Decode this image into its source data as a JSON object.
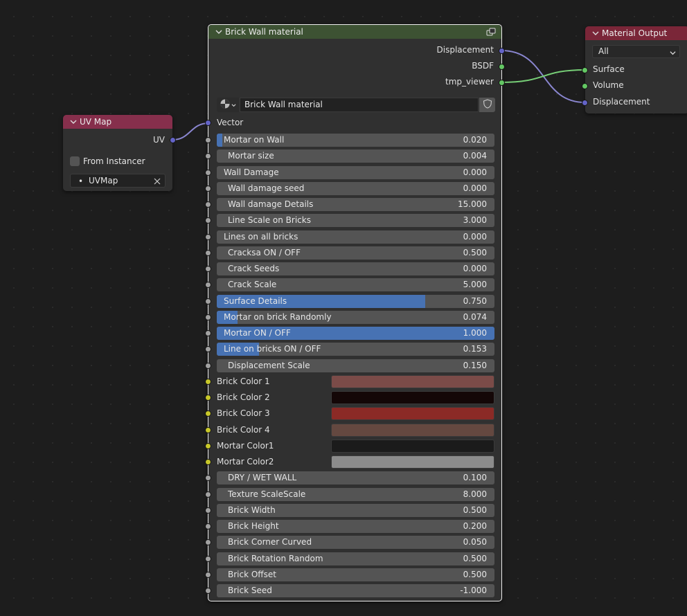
{
  "colors": {
    "main_header": "#3d5233",
    "uv_header": "#862f4c",
    "output_header": "#7a2638",
    "slider_fill": "#4772b3",
    "field_bg": "#545454"
  },
  "uv_node": {
    "title": "UV Map",
    "output_label": "UV",
    "from_instancer_label": "From Instancer",
    "from_instancer_checked": false,
    "uvmap_value": "UVMap"
  },
  "main_node": {
    "title": "Brick Wall material",
    "outputs": [
      "Displacement",
      "BSDF",
      "tmp_viewer"
    ],
    "datablock_name": "Brick Wall material",
    "vector_label": "Vector",
    "inputs": [
      {
        "label": "Mortar on Wall",
        "value": "0.020",
        "fill": 0.02
      },
      {
        "label": "Mortar size",
        "value": "0.004",
        "fill": 0
      },
      {
        "label": "Wall Damage",
        "value": "0.000",
        "fill": 0
      },
      {
        "label": "Wall damage seed",
        "value": "0.000",
        "fill": 0
      },
      {
        "label": "Wall damage Details",
        "value": "15.000",
        "fill": 0
      },
      {
        "label": "Line Scale on Bricks",
        "value": "3.000",
        "fill": 0
      },
      {
        "label": "Lines on all bricks",
        "value": "0.000",
        "fill": 0
      },
      {
        "label": "Cracksa ON / OFF",
        "value": "0.500",
        "fill": 0
      },
      {
        "label": "Crack Seeds",
        "value": "0.000",
        "fill": 0
      },
      {
        "label": "Crack Scale",
        "value": "5.000",
        "fill": 0
      },
      {
        "label": "Surface Details",
        "value": "0.750",
        "fill": 0.75
      },
      {
        "label": "Mortar on brick Randomly",
        "value": "0.074",
        "fill": 0.074
      },
      {
        "label": "Mortar ON / OFF",
        "value": "1.000",
        "fill": 1.0
      },
      {
        "label": "Line on bricks ON / OFF",
        "value": "0.153",
        "fill": 0.153
      },
      {
        "label": "Displacement Scale",
        "value": "0.150",
        "fill": 0
      }
    ],
    "colors": [
      {
        "label": "Brick Color 1",
        "color": "#7b4b48"
      },
      {
        "label": "Brick Color 2",
        "color": "#140707"
      },
      {
        "label": "Brick Color 3",
        "color": "#8b2a26"
      },
      {
        "label": "Brick Color 4",
        "color": "#644840"
      },
      {
        "label": "Mortar Color1",
        "color": "#1b1b1b"
      },
      {
        "label": "Mortar Color2",
        "color": "#8c8c8c"
      }
    ],
    "inputs2": [
      {
        "label": "DRY / WET WALL",
        "value": "0.100",
        "fill": 0
      },
      {
        "label": "Texture ScaleScale",
        "value": "8.000",
        "fill": 0
      },
      {
        "label": "Brick Width",
        "value": "0.500",
        "fill": 0
      },
      {
        "label": "Brick Height",
        "value": "0.200",
        "fill": 0
      },
      {
        "label": "Brick Corner Curved",
        "value": "0.050",
        "fill": 0
      },
      {
        "label": "Brick Rotation Random",
        "value": "0.500",
        "fill": 0
      },
      {
        "label": "Brick Offset",
        "value": "0.500",
        "fill": 0
      },
      {
        "label": "Brick Seed",
        "value": "-1.000",
        "fill": 0
      }
    ]
  },
  "output_node": {
    "title": "Material Output",
    "target": "All",
    "inputs": [
      "Surface",
      "Volume",
      "Displacement"
    ]
  }
}
